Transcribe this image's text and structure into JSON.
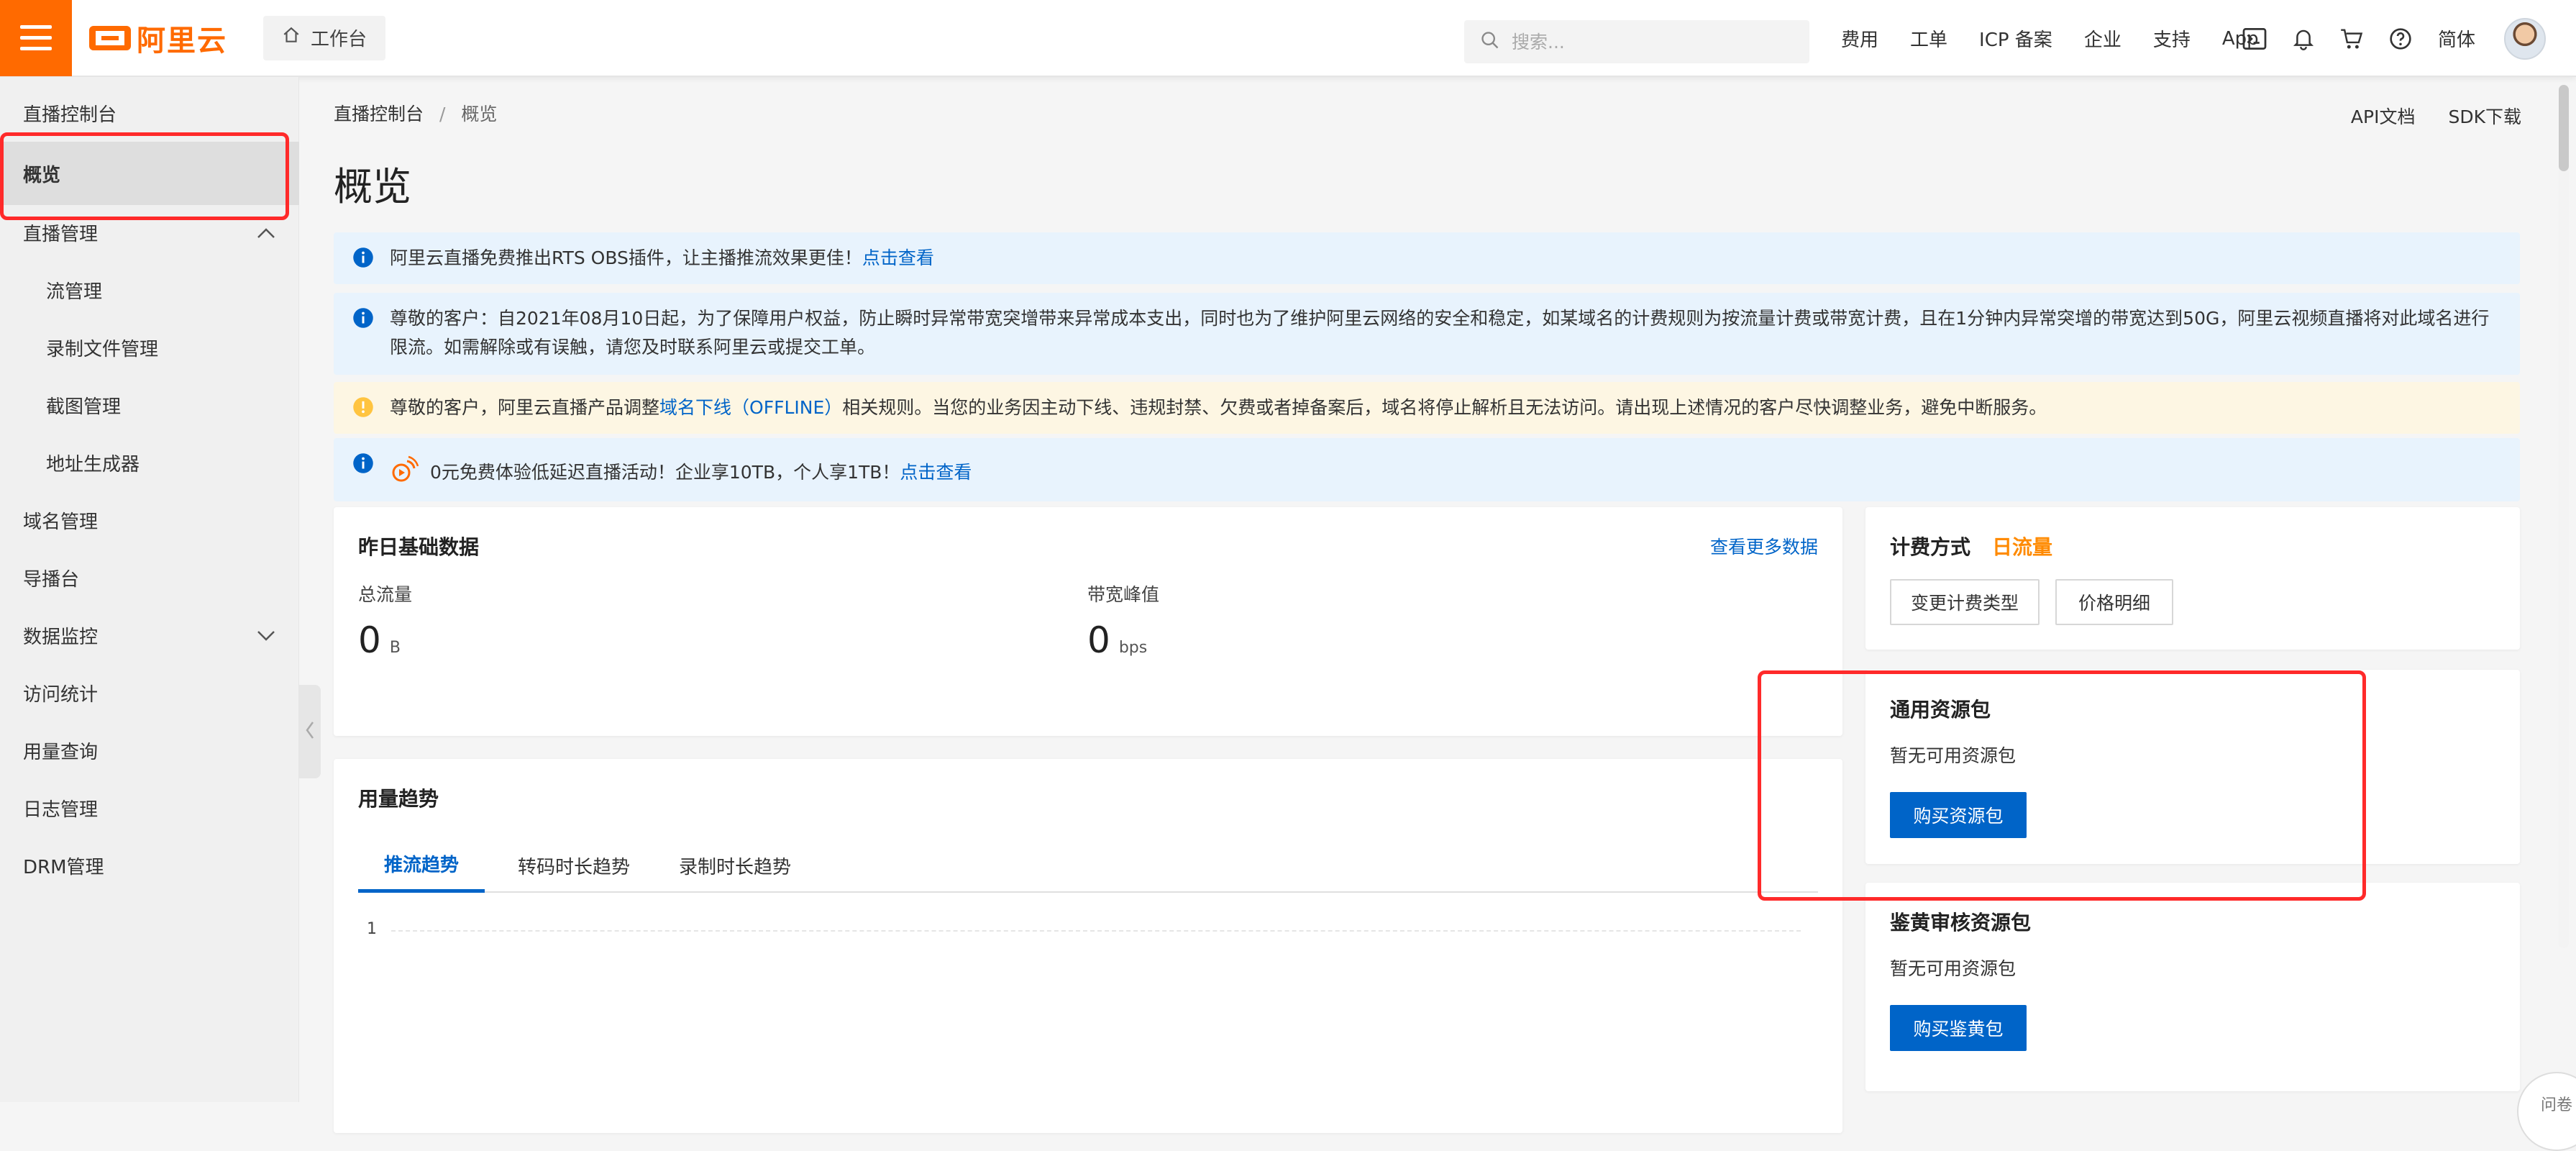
{
  "topbar": {
    "brand": "阿里云",
    "workbench": "工作台",
    "search_placeholder": "搜索...",
    "links": [
      "费用",
      "工单",
      "ICP 备案",
      "企业",
      "支持",
      "App"
    ],
    "lang": "简体",
    "icons": [
      "terminal-icon",
      "bell-icon",
      "cart-icon",
      "help-icon"
    ]
  },
  "sidebar": {
    "title": "直播控制台",
    "overview": "概览",
    "live_mgmt": "直播管理",
    "stream_mgmt": "流管理",
    "record_mgmt": "录制文件管理",
    "snapshot_mgmt": "截图管理",
    "address_gen": "地址生成器",
    "domain_mgmt": "域名管理",
    "director": "导播台",
    "monitoring": "数据监控",
    "access_stats": "访问统计",
    "usage_query": "用量查询",
    "log_mgmt": "日志管理",
    "drm_mgmt": "DRM管理"
  },
  "main": {
    "breadcrumb_root": "直播控制台",
    "breadcrumb_sep": "/",
    "breadcrumb_current": "概览",
    "api_doc": "API文档",
    "sdk_download": "SDK下载",
    "title": "概览",
    "notices": {
      "n1_text": "阿里云直播免费推出RTS OBS插件，让主播推流效果更佳！",
      "n1_link": "点击查看",
      "n2_text": "尊敬的客户：自2021年08月10日起，为了保障用户权益，防止瞬时异常带宽突增带来异常成本支出，同时也为了维护阿里云网络的安全和稳定，如某域名的计费规则为按流量计费或带宽计费，且在1分钟内异常突增的带宽达到50G，阿里云视频直播将对此域名进行限流。如需解除或有误触，请您及时联系阿里云或提交工单。",
      "n3_text_before": "尊敬的客户，阿里云直播产品调整",
      "n3_link": "域名下线（OFFLINE）",
      "n3_text_after": "相关规则。当您的业务因主动下线、违规封禁、欠费或者掉备案后，域名将停止解析且无法访问。请出现上述情况的客户尽快调整业务，避免中断服务。",
      "n4_text": "0元免费体验低延迟直播活动！企业享10TB，个人享1TB！",
      "n4_link": "点击查看"
    },
    "yesterday": {
      "title": "昨日基础数据",
      "more": "查看更多数据",
      "total_traffic_label": "总流量",
      "total_traffic_value": "0",
      "total_traffic_unit": "B",
      "peak_bw_label": "带宽峰值",
      "peak_bw_value": "0",
      "peak_bw_unit": "bps"
    },
    "trend": {
      "title": "用量趋势",
      "tabs": [
        "推流趋势",
        "转码时长趋势",
        "录制时长趋势"
      ],
      "y_tick": "1"
    }
  },
  "right": {
    "billing_label": "计费方式",
    "billing_type": "日流量",
    "change_billing": "变更计费类型",
    "price_detail": "价格明细",
    "general_pkg_title": "通用资源包",
    "general_pkg_empty": "暂无可用资源包",
    "buy_pkg": "购买资源包",
    "review_pkg_title": "鉴黄审核资源包",
    "review_pkg_empty": "暂无可用资源包",
    "buy_review": "购买鉴黄包"
  },
  "feedback": "问卷",
  "colors": {
    "brand_orange": "#ff6a00",
    "link_blue": "#0064c8",
    "highlight_red": "#ff2a2a",
    "info_bg": "#e8f3fd",
    "warn_bg": "#fdf6e3"
  }
}
